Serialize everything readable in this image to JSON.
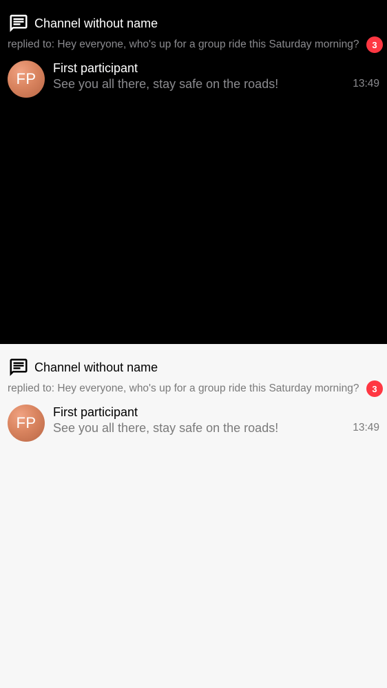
{
  "theme_dark": {
    "thread": {
      "icon": "chat-bubble-icon",
      "channel_name": "Channel without name",
      "reply_preview": "replied to: Hey everyone, who's up for a group ride this Saturday morning?",
      "unread_count": "3",
      "latest_message": {
        "avatar_initials": "FP",
        "author": "First participant",
        "text": "See you all there, stay safe on the roads!",
        "time": "13:49"
      }
    }
  },
  "theme_light": {
    "thread": {
      "icon": "chat-bubble-icon",
      "channel_name": "Channel without name",
      "reply_preview": "replied to: Hey everyone, who's up for a group ride this Saturday morning?",
      "unread_count": "3",
      "latest_message": {
        "avatar_initials": "FP",
        "author": "First participant",
        "text": "See you all there, stay safe on the roads!",
        "time": "13:49"
      }
    }
  },
  "colors": {
    "dark_background": "#000000",
    "light_background": "#f7f7f7",
    "badge": "#ff3742",
    "avatar": "#d9845f"
  }
}
